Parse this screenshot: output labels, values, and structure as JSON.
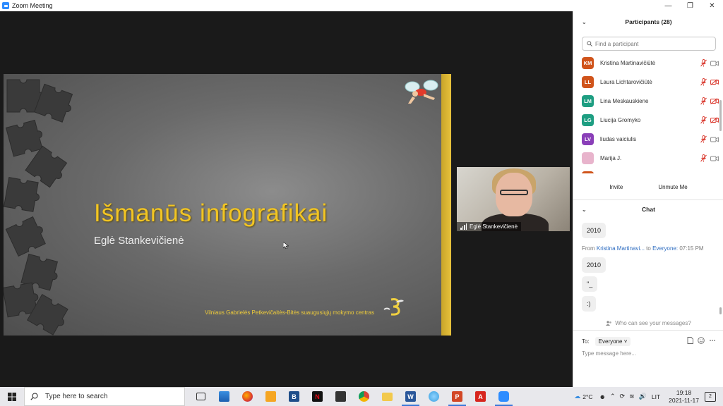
{
  "window": {
    "title": "Zoom Meeting",
    "controls": [
      "—",
      "❐",
      "✕"
    ]
  },
  "slide": {
    "title": "Išmanūs infografikai",
    "author": "Eglė Stankevičienė",
    "footer": "Vilniaus Gabrielės Petkevičaitės-Bitės suaugusiųjų mokymo centras"
  },
  "camera": {
    "name": "Eglė Stankevičienė"
  },
  "participants": {
    "title": "Participants (28)",
    "search_placeholder": "Find a participant",
    "items": [
      {
        "initials": "KM",
        "name": "Kristina Martinavičiūtė",
        "color": "#d0541b",
        "video_off": false
      },
      {
        "initials": "LL",
        "name": "Laura Lichtarovičiūtė",
        "color": "#d0541b",
        "video_off": true
      },
      {
        "initials": "LM",
        "name": "Lina Meskauskiene",
        "color": "#1e9e82",
        "video_off": true
      },
      {
        "initials": "LG",
        "name": "Liucija Gromyko",
        "color": "#1e9e82",
        "video_off": true
      },
      {
        "initials": "LV",
        "name": "liudas vaiciulis",
        "color": "#8a3fb8",
        "video_off": false
      },
      {
        "initials": "",
        "name": "Marija J.",
        "color": "#e8b4cc",
        "video_off": false
      }
    ],
    "invite_label": "Invite",
    "unmute_label": "Unmute Me"
  },
  "chat": {
    "title": "Chat",
    "messages": [
      {
        "text": "2010"
      },
      {
        "text": "2010"
      },
      {
        "text": "\"_"
      },
      {
        "text": ":)"
      }
    ],
    "meta": {
      "from_label": "From",
      "sender": "Kristina Martinavi...",
      "to_label": "to",
      "recipient": "Everyone:",
      "time": "07:15 PM"
    },
    "who_can_see": "Who can see your messages?",
    "to_label": "To:",
    "to_value": "Everyone",
    "input_placeholder": "Type message here..."
  },
  "taskbar": {
    "search_placeholder": "Type here to search",
    "weather": "2°C",
    "language": "LIT",
    "time": "19:18",
    "date": "2021-11-17",
    "notifications": "2"
  },
  "colors": {
    "slide_title": "#f2c523",
    "accent_blue": "#2d8cff",
    "mute_red": "#d9352a"
  }
}
